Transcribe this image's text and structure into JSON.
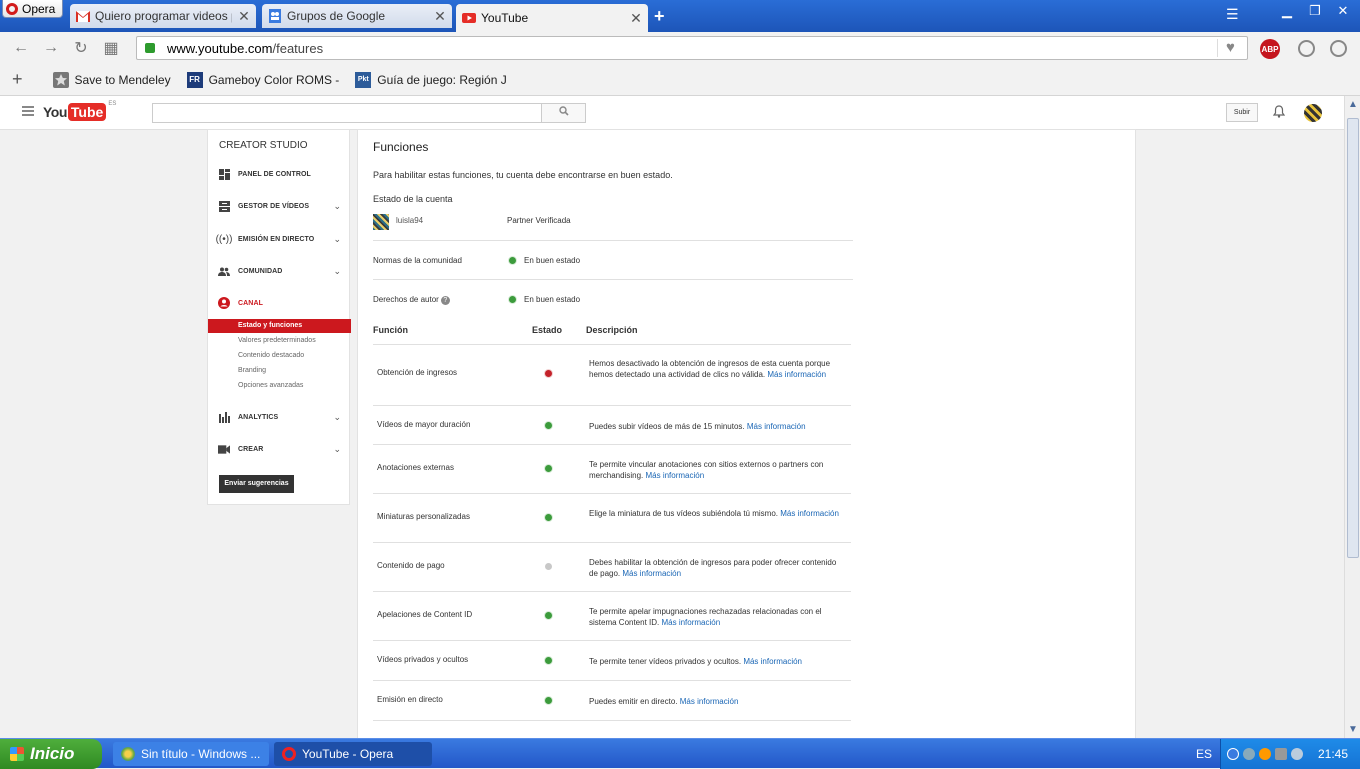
{
  "browser": {
    "menu_label": "Opera",
    "tabs": [
      {
        "label": "Quiero programar videos para",
        "icon": "gmail-icon"
      },
      {
        "label": "Grupos de Google",
        "icon": "google-groups-icon"
      },
      {
        "label": "YouTube",
        "icon": "youtube-icon",
        "active": true
      }
    ],
    "url_host": "www.youtube.com",
    "url_path": "/features",
    "abp_label": "ABP",
    "bookmarks": [
      {
        "label": "Save to Mendeley",
        "icon": "star-icon"
      },
      {
        "label": "Gameboy Color ROMS -",
        "icon": "fr-icon"
      },
      {
        "label": "Guía de juego: Región J",
        "icon": "pkt-icon"
      }
    ]
  },
  "youtube": {
    "logo_you": "You",
    "logo_tube": "Tube",
    "logo_region": "ES",
    "search_placeholder": "",
    "upload_label": "Subir"
  },
  "sidebar": {
    "title": "CREATOR STUDIO",
    "items": [
      {
        "label": "PANEL DE CONTROL",
        "icon": "dashboard-icon"
      },
      {
        "label": "GESTOR DE VÍDEOS",
        "icon": "video-manager-icon"
      },
      {
        "label": "EMISIÓN EN DIRECTO",
        "icon": "live-icon"
      },
      {
        "label": "COMUNIDAD",
        "icon": "community-icon"
      },
      {
        "label": "CANAL",
        "icon": "channel-icon"
      },
      {
        "label": "ANALYTICS",
        "icon": "analytics-icon"
      },
      {
        "label": "CREAR",
        "icon": "camera-icon"
      }
    ],
    "subitems": [
      "Estado y funciones",
      "Valores predeterminados",
      "Contenido destacado",
      "Branding",
      "Opciones avanzadas"
    ],
    "feedback_label": "Enviar sugerencias"
  },
  "main": {
    "title": "Funciones",
    "description": "Para habilitar estas funciones, tu cuenta debe encontrarse en buen estado.",
    "account_state_label": "Estado de la cuenta",
    "username": "luisla94",
    "partner_status": "Partner Verificada",
    "community_label": "Normas de la comunidad",
    "community_status": "En buen estado",
    "copyright_label": "Derechos de autor",
    "copyright_status": "En buen estado",
    "help_glyph": "?",
    "columns": {
      "feature": "Función",
      "state": "Estado",
      "description": "Descripción"
    },
    "link_text": "Más información",
    "features": [
      {
        "name": "Obtención de ingresos",
        "status": "red",
        "desc": "Hemos desactivado la obtención de ingresos de esta cuenta porque hemos detectado una actividad de clics no válida."
      },
      {
        "name": "Vídeos de mayor duración",
        "status": "green",
        "desc": "Puedes subir vídeos de más de 15 minutos."
      },
      {
        "name": "Anotaciones externas",
        "status": "green",
        "desc": "Te permite vincular anotaciones con sitios externos o partners con merchandising."
      },
      {
        "name": "Miniaturas personalizadas",
        "status": "green",
        "desc": "Elige la miniatura de tus vídeos subiéndola tú mismo."
      },
      {
        "name": "Contenido de pago",
        "status": "gray",
        "desc": "Debes habilitar la obtención de ingresos para poder ofrecer contenido de pago."
      },
      {
        "name": "Apelaciones de Content ID",
        "status": "green",
        "desc": "Te permite apelar impugnaciones rechazadas relacionadas con el sistema Content ID."
      },
      {
        "name": "Vídeos privados y ocultos",
        "status": "green",
        "desc": "Te permite tener vídeos privados y ocultos."
      },
      {
        "name": "Emisión en directo",
        "status": "green",
        "desc": "Puedes emitir en directo."
      }
    ]
  },
  "taskbar": {
    "start_label": "Inicio",
    "tasks": [
      {
        "label": "Sin título - Windows ...",
        "icon": "paint-icon"
      },
      {
        "label": "YouTube - Opera",
        "icon": "opera-icon"
      }
    ],
    "language": "ES",
    "clock": "21:45"
  },
  "colors": {
    "accent_red": "#cc181e",
    "link_blue": "#1a66b5",
    "status_green": "#3c9b3c",
    "status_red": "#c4222a"
  }
}
